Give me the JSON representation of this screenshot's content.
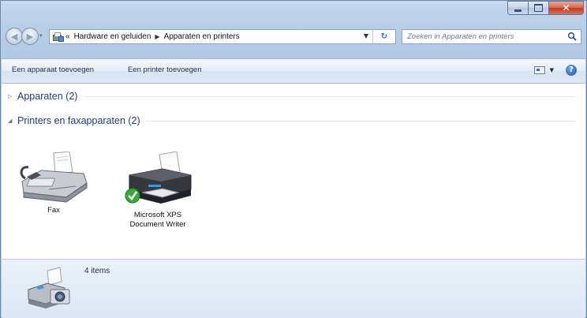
{
  "window": {
    "caption_buttons": [
      "minimize",
      "maximize",
      "close"
    ]
  },
  "address": {
    "overflow": "«",
    "breadcrumbs": [
      "Hardware en geluiden",
      "Apparaten en printers"
    ]
  },
  "search": {
    "placeholder": "Zoeken in Apparaten en printers"
  },
  "toolbar": {
    "add_device": "Een apparaat toevoegen",
    "add_printer": "Een printer toevoegen",
    "help": "?"
  },
  "groups": {
    "devices": "Apparaten (2)",
    "printers": "Printers en faxapparaten (2)"
  },
  "items": [
    {
      "label_line1": "Fax",
      "label_line2": "",
      "icon": "fax-icon"
    },
    {
      "label_line1": "Microsoft XPS",
      "label_line2": "Document Writer",
      "icon": "printer-icon",
      "default": true
    }
  ],
  "details": {
    "count": "4 items"
  },
  "colors": {
    "frame": "#b9cfe8",
    "toolbar": "#dde8f4",
    "group_header": "#1e3d7a",
    "default_check": "#3aa83a"
  }
}
